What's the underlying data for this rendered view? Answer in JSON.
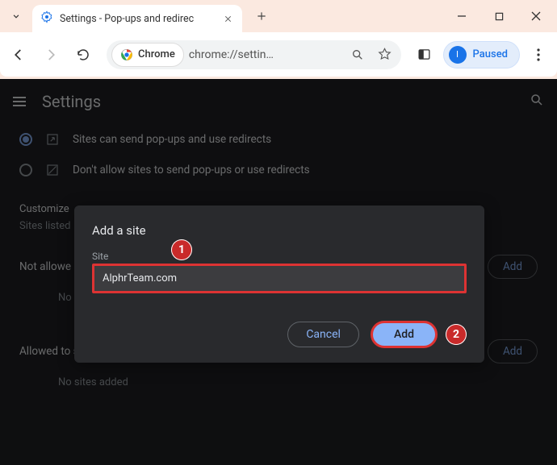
{
  "tab": {
    "title": "Settings - Pop-ups and redirec"
  },
  "omnibox": {
    "chip": "Chrome",
    "url": "chrome://settin…"
  },
  "profile": {
    "initial": "I",
    "label": "Paused"
  },
  "settings": {
    "header": "Settings",
    "radio_allow": "Sites can send pop-ups and use redirects",
    "radio_block": "Don't allow sites to send pop-ups or use redirects",
    "customize_heading": "Customize",
    "customize_sub": "Sites listed",
    "not_allowed_label": "Not allowe",
    "not_allowed_empty": "No s",
    "allowed_label": "Allowed to send pop-ups and use redirects",
    "allowed_empty": "No sites added",
    "add_label": "Add"
  },
  "dialog": {
    "title": "Add a site",
    "input_label": "Site",
    "input_value": "AlphrTeam.com",
    "cancel": "Cancel",
    "add": "Add"
  },
  "annotations": {
    "one": "1",
    "two": "2"
  }
}
